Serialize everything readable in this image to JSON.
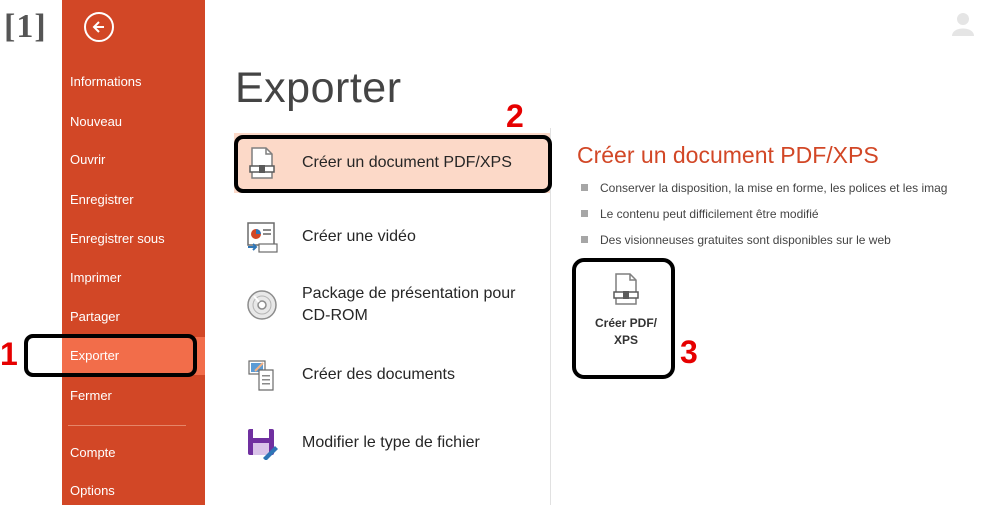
{
  "figure_label": "[1]",
  "sidebar": {
    "items": [
      {
        "label": "Informations"
      },
      {
        "label": "Nouveau"
      },
      {
        "label": "Ouvrir"
      },
      {
        "label": "Enregistrer"
      },
      {
        "label": "Enregistrer sous"
      },
      {
        "label": "Imprimer"
      },
      {
        "label": "Partager"
      },
      {
        "label": "Exporter",
        "active": true
      },
      {
        "label": "Fermer"
      },
      {
        "label": "Compte"
      },
      {
        "label": "Options"
      }
    ],
    "accent": "#d24726",
    "active_color": "#f26d4a"
  },
  "main": {
    "title": "Exporter",
    "export_options": [
      {
        "label": "Créer un document PDF/XPS",
        "icon": "pdf-document-icon",
        "selected": true
      },
      {
        "label": "Créer une vidéo",
        "icon": "video-icon"
      },
      {
        "label_line1": "Package de présentation pour",
        "label_line2": "CD-ROM",
        "icon": "cd-rom-icon"
      },
      {
        "label": "Créer des documents",
        "icon": "handouts-icon"
      },
      {
        "label": "Modifier le type de fichier",
        "icon": "save-as-type-icon"
      }
    ]
  },
  "detail": {
    "title": "Créer un document PDF/XPS",
    "bullets": [
      "Conserver la disposition, la mise en forme, les polices et les imag",
      "Le contenu peut difficilement être modifié",
      "Des visionneuses gratuites sont disponibles sur le web"
    ],
    "button_label_line1": "Créer PDF/",
    "button_label_line2": "XPS"
  },
  "callouts": {
    "one": "1",
    "two": "2",
    "three": "3",
    "color": "#e60000"
  }
}
